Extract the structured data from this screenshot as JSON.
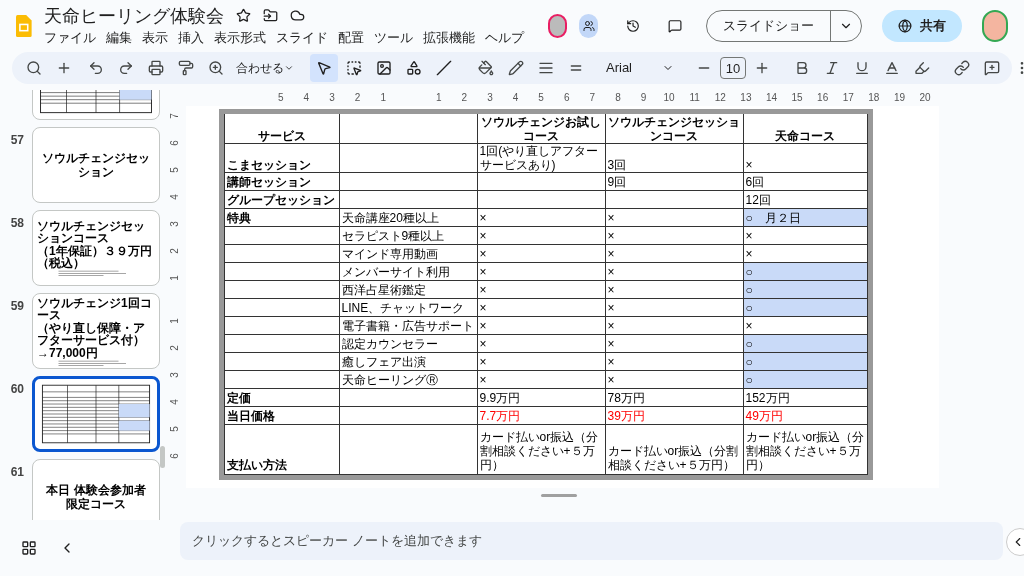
{
  "document": {
    "title": "天命ヒーリング体験会"
  },
  "menu": [
    "ファイル",
    "編集",
    "表示",
    "挿入",
    "表示形式",
    "スライド",
    "配置",
    "ツール",
    "拡張機能",
    "ヘルプ"
  ],
  "header_actions": {
    "slideshow": "スライドショー",
    "share": "共有"
  },
  "toolbar": {
    "zoom": "合わせる",
    "font": "Arial",
    "font_size": "10",
    "tools": [
      {
        "kind": "select",
        "selected": true
      },
      {
        "kind": "textbox",
        "selected": false
      },
      {
        "kind": "image",
        "selected": false
      },
      {
        "kind": "shape",
        "selected": false
      },
      {
        "kind": "line",
        "selected": false
      }
    ]
  },
  "slides": [
    {
      "kind": "table",
      "selected": false
    },
    {
      "number": "57",
      "kind": "title",
      "lines": [
        "ソウルチェンジセッション"
      ],
      "selected": false
    },
    {
      "number": "58",
      "kind": "text",
      "lines": [
        "ソウルチェンジセッションコース",
        "（1年保証）３９万円（税込）"
      ],
      "selected": false
    },
    {
      "number": "59",
      "kind": "text",
      "lines": [
        "ソウルチェンジ1回コース",
        "（やり直し保障・アフターサービス付）",
        "→77,000円"
      ],
      "selected": false
    },
    {
      "number": "60",
      "kind": "table",
      "selected": true
    },
    {
      "number": "61",
      "kind": "title",
      "lines": [
        "本日 体験会参加者",
        "限定コース"
      ],
      "selected": false
    }
  ],
  "horizontal_ruler": [
    "5",
    "4",
    "3",
    "2",
    "1",
    "1",
    "2",
    "3",
    "4",
    "5",
    "6",
    "7",
    "8",
    "9",
    "10",
    "11",
    "12",
    "13",
    "14",
    "15",
    "16",
    "17",
    "18",
    "19",
    "20"
  ],
  "vertical_ruler": [
    "7",
    "6",
    "5",
    "4",
    "3",
    "2",
    "1",
    "1",
    "2",
    "3",
    "4",
    "5",
    "6"
  ],
  "table": {
    "header": {
      "service": "サービス",
      "trial": "ソウルチェンジお試しコース",
      "session": "ソウルチェンジセッションコース",
      "tenmei": "天命コース"
    },
    "rows": [
      {
        "kind": "wrap",
        "service": "こまセッション",
        "trial": "1回(やり直しアフターサービスあり)",
        "session": "3回",
        "tenmei": "×",
        "tenmei_highlighted": false
      },
      {
        "kind": "plain",
        "service": "講師セッション",
        "session": "9回",
        "tenmei": "6回",
        "tenmei_highlighted": false
      },
      {
        "kind": "plain",
        "service": "グループセッション",
        "tenmei": "12回",
        "tenmei_highlighted": false
      },
      {
        "kind": "plain",
        "service": "特典",
        "column_2": "天命講座20種以上",
        "trial": "×",
        "session": "×",
        "tenmei": "○　月２日",
        "tenmei_highlighted": true
      },
      {
        "kind": "plain",
        "column_2": "セラピスト9種以上",
        "trial": "×",
        "session": "×",
        "tenmei": "×",
        "tenmei_highlighted": false
      },
      {
        "kind": "plain",
        "column_2": "マインド専用動画",
        "trial": "×",
        "session": "×",
        "tenmei": "×",
        "tenmei_highlighted": false
      },
      {
        "kind": "plain",
        "column_2": "メンバーサイト利用",
        "trial": "×",
        "session": "×",
        "tenmei": "○",
        "tenmei_highlighted": true
      },
      {
        "kind": "plain",
        "column_2": "西洋占星術鑑定",
        "trial": "×",
        "session": "×",
        "tenmei": "○",
        "tenmei_highlighted": true
      },
      {
        "kind": "plain",
        "column_2": "LINE、チャットワーク",
        "trial": "×",
        "session": "×",
        "tenmei": "○",
        "tenmei_highlighted": true
      },
      {
        "kind": "plain",
        "column_2": "電子書籍・広告サポート",
        "trial": "×",
        "session": "×",
        "tenmei": "×",
        "tenmei_highlighted": false
      },
      {
        "kind": "plain",
        "column_2": "認定カウンセラー",
        "trial": "×",
        "session": "×",
        "tenmei": "○",
        "tenmei_highlighted": true
      },
      {
        "kind": "plain",
        "column_2": "癒しフェア出演",
        "trial": "×",
        "session": "×",
        "tenmei": "○",
        "tenmei_highlighted": true
      },
      {
        "kind": "plain",
        "column_2": "天命ヒーリングⓇ",
        "trial": "×",
        "session": "×",
        "tenmei": "○",
        "tenmei_highlighted": true
      },
      {
        "kind": "plain",
        "service": "定価",
        "trial": "9.9万円",
        "session": "78万円",
        "tenmei": "152万円",
        "tenmei_highlighted": false
      },
      {
        "kind": "sale",
        "service": "当日価格",
        "trial": "7.7万円",
        "session": "39万円",
        "tenmei": "49万円",
        "tenmei_highlighted": false
      },
      {
        "kind": "payment",
        "service": "支払い方法",
        "trial": "カード払いor振込（分割相談ください+５万円）",
        "session": "カード払いor振込（分割相談ください+５万円）",
        "tenmei": "カード払いor振込（分割相談ください+５万円）",
        "tenmei_highlighted": false
      }
    ]
  },
  "speaker_notes": {
    "placeholder": "クリックするとスピーカー ノートを追加できます"
  }
}
